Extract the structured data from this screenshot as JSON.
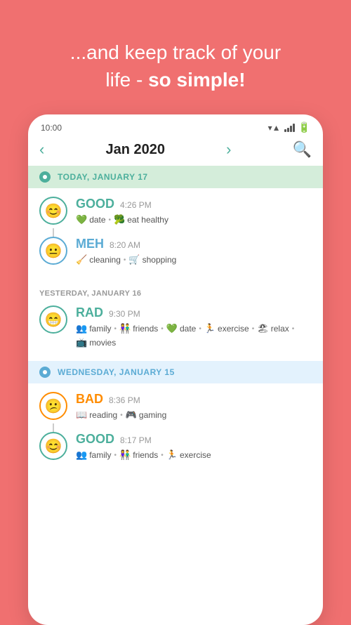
{
  "hero": {
    "line1": "...and keep track of your",
    "line2_prefix": "life - ",
    "line2_bold": "so simple!"
  },
  "statusBar": {
    "time": "10:00"
  },
  "nav": {
    "title": "Jan 2020",
    "prev": "‹",
    "next": "›"
  },
  "days": [
    {
      "id": "today",
      "type": "today",
      "label": "TODAY, JANUARY 17",
      "entries": [
        {
          "mood": "GOOD",
          "moodClass": "good",
          "time": "4:26 PM",
          "tags": [
            {
              "icon": "💚",
              "label": "date"
            },
            {
              "icon": "🥦",
              "label": "eat healthy"
            }
          ]
        },
        {
          "mood": "MEH",
          "moodClass": "meh",
          "time": "8:20 AM",
          "tags": [
            {
              "icon": "🧹",
              "label": "cleaning"
            },
            {
              "icon": "🛒",
              "label": "shopping"
            }
          ]
        }
      ]
    },
    {
      "id": "yesterday",
      "type": "standalone",
      "label": "YESTERDAY, JANUARY 16",
      "entries": [
        {
          "mood": "RAD",
          "moodClass": "rad",
          "time": "9:30 PM",
          "tags": [
            {
              "icon": "👥",
              "label": "family"
            },
            {
              "icon": "👫",
              "label": "friends"
            },
            {
              "icon": "💚",
              "label": "date"
            },
            {
              "icon": "🏃",
              "label": "exercise"
            },
            {
              "icon": "🏖",
              "label": "relax"
            },
            {
              "icon": "📺",
              "label": "movies"
            }
          ]
        }
      ]
    },
    {
      "id": "wednesday",
      "type": "wednesday",
      "label": "WEDNESDAY, JANUARY 15",
      "entries": [
        {
          "mood": "BAD",
          "moodClass": "bad",
          "time": "8:36 PM",
          "tags": [
            {
              "icon": "📖",
              "label": "reading"
            },
            {
              "icon": "🎮",
              "label": "gaming"
            }
          ]
        },
        {
          "mood": "GOOD",
          "moodClass": "good",
          "time": "8:17 PM",
          "tags": [
            {
              "icon": "👥",
              "label": "family"
            },
            {
              "icon": "👫",
              "label": "friends"
            },
            {
              "icon": "🏃",
              "label": "exercise"
            }
          ]
        }
      ]
    }
  ]
}
